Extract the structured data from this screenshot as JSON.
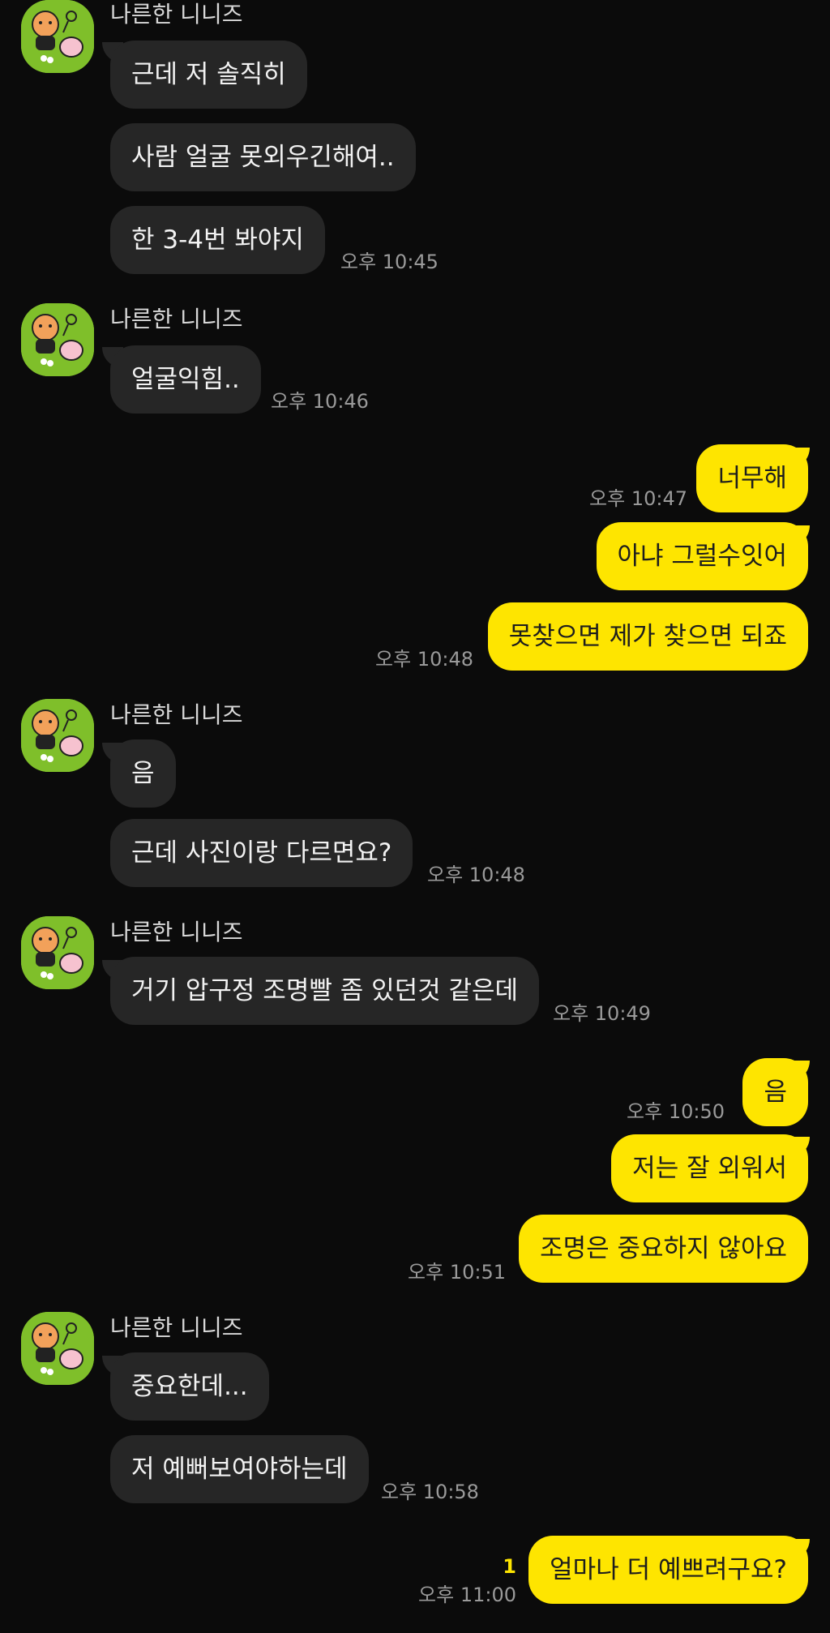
{
  "sender_name": "나른한 니니즈",
  "groups": [
    {
      "messages": [
        "근데 저 솔직히",
        "사람 얼굴 못외우긴해여..",
        "한 3-4번 봐야지"
      ],
      "time": "오후 10:45"
    },
    {
      "messages": [
        "얼굴익힘.."
      ],
      "time": "오후 10:46"
    },
    {
      "messages": [
        "음",
        "근데 사진이랑 다르면요?"
      ],
      "time": "오후 10:48"
    },
    {
      "messages": [
        "거기 압구정 조명빨 좀 있던것 같은데"
      ],
      "time": "오후 10:49"
    },
    {
      "messages": [
        "중요한데...",
        "저 예뻐보여야하는데"
      ],
      "time": "오후 10:58"
    }
  ],
  "mine": [
    {
      "messages": [
        "너무해"
      ],
      "time": "오후 10:47"
    },
    {
      "messages": [
        "아냐 그럴수잇어",
        "못찾으면 제가 찾으면 되죠"
      ],
      "time": "오후 10:48"
    },
    {
      "messages": [
        "음"
      ],
      "time": "오후 10:50"
    },
    {
      "messages": [
        "저는 잘 외워서",
        "조명은 중요하지 않아요"
      ],
      "time": "오후 10:51"
    },
    {
      "messages": [
        "얼마나 더 예쁘려구요?"
      ],
      "time": "오후 11:00",
      "unread": "1"
    }
  ],
  "colors": {
    "background": "#0b0b0b",
    "incoming_bubble": "#262626",
    "outgoing_bubble": "#fee500",
    "avatar_bg": "#7fbf2a"
  },
  "icons": {
    "avatar": "sleepy-niniz-character-icon"
  }
}
